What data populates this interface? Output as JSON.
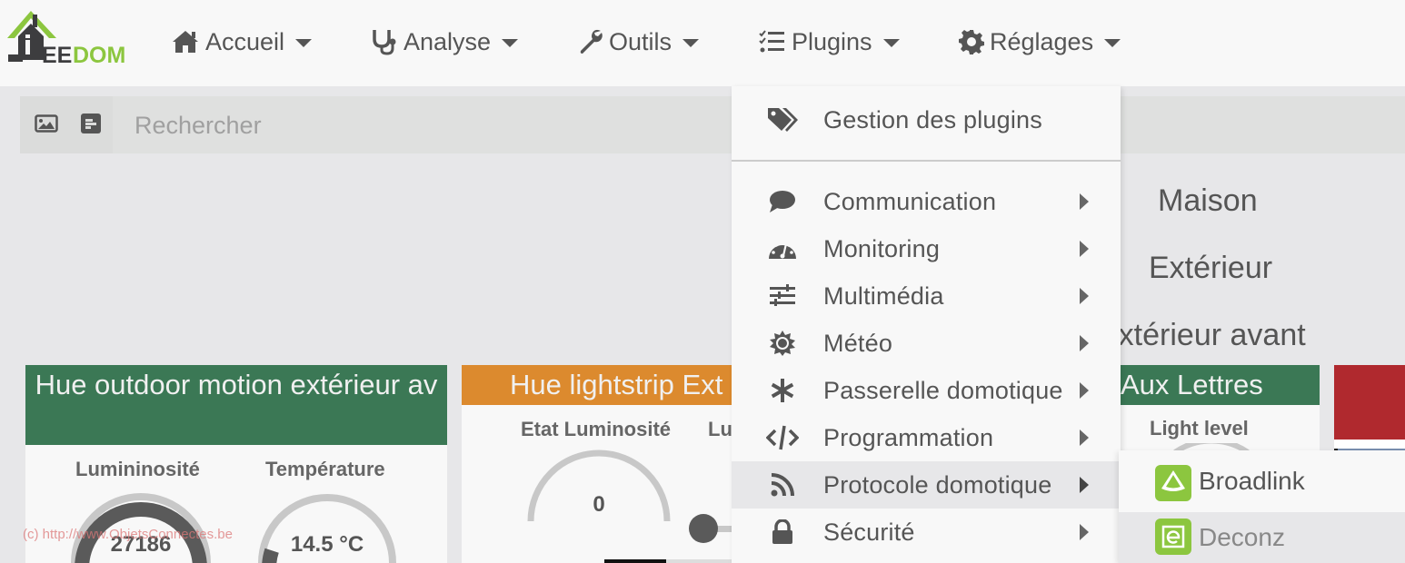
{
  "app": {
    "logo_text_dark": "EE",
    "logo_text_green": "DOM",
    "logo_alt": "Jeedom"
  },
  "nav": {
    "items": [
      {
        "label": "Accueil",
        "icon": "home-icon"
      },
      {
        "label": "Analyse",
        "icon": "stethoscope-icon"
      },
      {
        "label": "Outils",
        "icon": "wrench-icon"
      },
      {
        "label": "Plugins",
        "icon": "tasks-icon"
      },
      {
        "label": "Réglages",
        "icon": "gear-icon"
      }
    ]
  },
  "search": {
    "placeholder": "Rechercher",
    "value": "",
    "buttons": [
      {
        "icon": "image-icon"
      },
      {
        "icon": "list-icon"
      }
    ]
  },
  "objects": {
    "titles": [
      "Maison",
      "Extérieur",
      "Extérieur avant"
    ]
  },
  "widgets": [
    {
      "title": "Hue outdoor motion extérieur av",
      "header_color": "#3b7855",
      "commands": [
        {
          "label": "Lumininosité",
          "value": "27186",
          "fill": 1.0
        },
        {
          "label": "Température",
          "value": "14.5 °C",
          "fill": 0.1
        }
      ]
    },
    {
      "title": "Hue lightstrip Ext",
      "header_color": "#dc8a2e",
      "commands": [
        {
          "label": "Etat Luminosité",
          "value": "0",
          "fill": 0
        },
        {
          "label": "Lu",
          "slider_value": 0
        }
      ]
    },
    {
      "title": "Aux Lettres",
      "header_color": "#3b7855",
      "commands": [
        {
          "label": "Light level"
        }
      ]
    },
    {
      "title": "",
      "header_color": "#b0292e"
    }
  ],
  "plugins_menu": {
    "manage": {
      "label": "Gestion des plugins",
      "icon": "tags-icon"
    },
    "categories": [
      {
        "label": "Communication",
        "icon": "comment-icon"
      },
      {
        "label": "Monitoring",
        "icon": "dashboard-icon"
      },
      {
        "label": "Multimédia",
        "icon": "sliders-icon"
      },
      {
        "label": "Météo",
        "icon": "sun-icon"
      },
      {
        "label": "Passerelle domotique",
        "icon": "asterisk-icon"
      },
      {
        "label": "Programmation",
        "icon": "code-icon"
      },
      {
        "label": "Protocole domotique",
        "icon": "rss-icon",
        "active": true
      },
      {
        "label": "Sécurité",
        "icon": "lock-icon"
      }
    ]
  },
  "submenu": {
    "items": [
      {
        "label": "Broadlink",
        "icon": "broadlink-icon"
      },
      {
        "label": "Deconz",
        "icon": "deconz-icon"
      }
    ]
  },
  "watermark": "(c) http://www.ObjetsConnectes.be",
  "colors": {
    "accent_green": "#8cc63f",
    "widget_green": "#3b7855",
    "widget_orange": "#dc8a2e",
    "widget_red": "#b0292e",
    "text": "#555555"
  }
}
